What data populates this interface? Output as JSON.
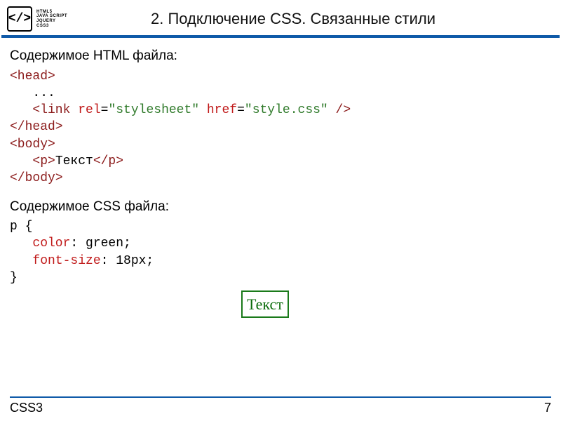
{
  "header": {
    "logo_symbol": "</>",
    "logo_lines": [
      "HTML5",
      "JAVA SCRIPT",
      "JQUERY",
      "CSS3"
    ],
    "title": "2. Подключение CSS. Связанные стили"
  },
  "content": {
    "html_label": "Содержимое HTML файла:",
    "code_html": {
      "head_open": "<head>",
      "ellipsis": "   ...",
      "link_indent": "   ",
      "link_open": "<link",
      "rel_attr": " rel",
      "eq1": "=",
      "rel_val": "\"stylesheet\"",
      "href_attr": " href",
      "eq2": "=",
      "href_val": "\"style.css\"",
      "link_close": " />",
      "head_close": "</head>",
      "body_open": "<body>",
      "p_indent": "   ",
      "p_open": "<p>",
      "p_text": "Текст",
      "p_close": "</p>",
      "body_close": "</body>"
    },
    "css_label": "Содержимое CSS файла:",
    "code_css": {
      "sel_open": "p {",
      "indent": "   ",
      "prop1": "color",
      "val1": ": green;",
      "prop2": "font-size",
      "val2": ": 18px;",
      "close": "}"
    },
    "render_sample": "Текст"
  },
  "footer": {
    "left": "CSS3",
    "page": "7"
  }
}
